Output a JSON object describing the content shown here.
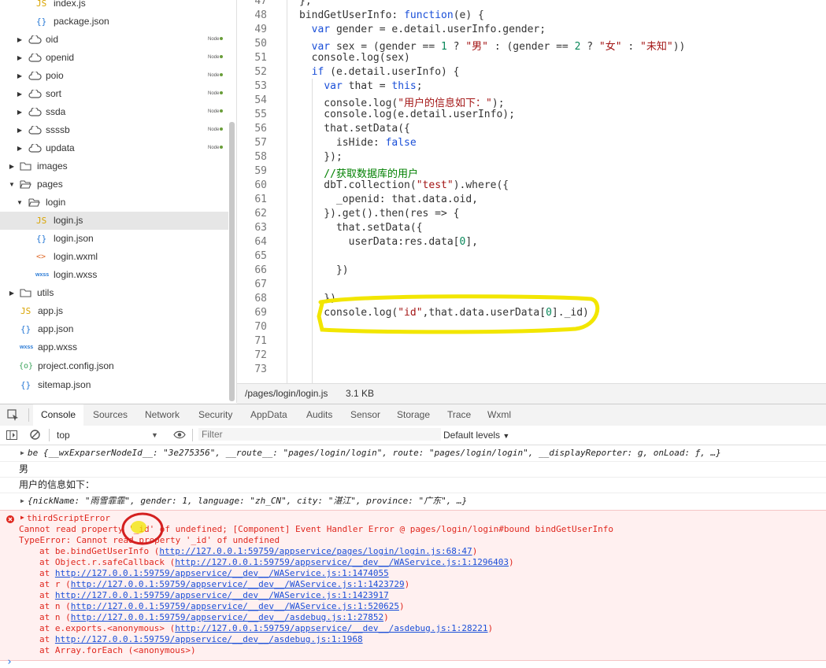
{
  "file_tree": [
    {
      "label": "index.js",
      "icon": "js-file-icon",
      "badge": ""
    },
    {
      "label": "package.json",
      "icon": "json-file-icon",
      "badge": ""
    },
    {
      "label": "oid",
      "icon": "cloud-function-icon",
      "badge": "Node"
    },
    {
      "label": "openid",
      "icon": "cloud-function-icon",
      "badge": "Node"
    },
    {
      "label": "poio",
      "icon": "cloud-function-icon",
      "badge": "Node"
    },
    {
      "label": "sort",
      "icon": "cloud-function-icon",
      "badge": "Node"
    },
    {
      "label": "ssda",
      "icon": "cloud-function-icon",
      "badge": "Node"
    },
    {
      "label": "ssssb",
      "icon": "cloud-function-icon",
      "badge": "Node"
    },
    {
      "label": "updata",
      "icon": "cloud-function-icon",
      "badge": "Node"
    },
    {
      "label": "images",
      "icon": "folder-icon",
      "badge": ""
    },
    {
      "label": "pages",
      "icon": "folder-open-icon",
      "badge": ""
    },
    {
      "label": "login",
      "icon": "folder-open-icon",
      "badge": ""
    },
    {
      "label": "login.js",
      "icon": "js-file-icon",
      "badge": ""
    },
    {
      "label": "login.json",
      "icon": "json-file-icon",
      "badge": ""
    },
    {
      "label": "login.wxml",
      "icon": "wxml-file-icon",
      "badge": ""
    },
    {
      "label": "login.wxss",
      "icon": "wxss-file-icon",
      "badge": ""
    },
    {
      "label": "utils",
      "icon": "folder-icon",
      "badge": ""
    },
    {
      "label": "app.js",
      "icon": "js-file-icon",
      "badge": ""
    },
    {
      "label": "app.json",
      "icon": "json-file-icon",
      "badge": ""
    },
    {
      "label": "app.wxss",
      "icon": "wxss-file-icon",
      "badge": ""
    },
    {
      "label": "project.config.json",
      "icon": "config-file-icon",
      "badge": ""
    },
    {
      "label": "sitemap.json",
      "icon": "json-file-icon",
      "badge": ""
    }
  ],
  "editor": {
    "line_numbers": [
      "47",
      "48",
      "49",
      "50",
      "51",
      "52",
      "53",
      "54",
      "55",
      "56",
      "57",
      "58",
      "59",
      "60",
      "61",
      "62",
      "63",
      "64",
      "65",
      "66",
      "67",
      "68",
      "69",
      "70",
      "71",
      "72",
      "73"
    ],
    "lines": [
      "},",
      "bindGetUserInfo: function(e) {",
      "  var gender = e.detail.userInfo.gender;",
      "  var sex = (gender == 1 ? \"男\" : (gender == 2 ? \"女\" : \"未知\"))",
      "  console.log(sex)",
      "  if (e.detail.userInfo) {",
      "    var that = this;",
      "    console.log(\"用户的信息如下：\");",
      "    console.log(e.detail.userInfo);",
      "    that.setData({",
      "      isHide: false",
      "    });",
      "    //获取数据库的用户",
      "    dbT.collection(\"test\").where({",
      "      _openid: that.data.oid,",
      "    }).get().then(res => {",
      "      that.setData({",
      "        userData:res.data[0],",
      "",
      "      })",
      "",
      "    })",
      "    console.log(\"id\",that.data.userData[0]._id)",
      "",
      "",
      "",
      ""
    ]
  },
  "status_bar": {
    "path": "/pages/login/login.js",
    "size": "3.1 KB"
  },
  "devtools_tabs": [
    "Console",
    "Sources",
    "Network",
    "Security",
    "AppData",
    "Audits",
    "Sensor",
    "Storage",
    "Trace",
    "Wxml"
  ],
  "filter_bar": {
    "context": "top",
    "filter_placeholder": "Filter",
    "levels": "Default levels"
  },
  "console": {
    "row1": "be {__wxExparserNodeId__: \"3e275356\", __route__: \"pages/login/login\", route: \"pages/login/login\", __displayReporter: g, onLoad: ƒ, …}",
    "row2": "男",
    "row3": "用户的信息如下：",
    "row4": "{nickName: \"雨雪霏霏\", gender: 1, language: \"zh_CN\", city: \"湛江\", province: \"广东\", …}",
    "error_title": "thirdScriptError",
    "error_lines": [
      "Cannot read property '_id' of undefined; [Component] Event Handler Error @ pages/login/login#bound bindGetUserInfo",
      "TypeError: Cannot read property '_id' of undefined"
    ],
    "stack": [
      {
        "at": "at be.bindGetUserInfo (",
        "url": "http://127.0.0.1:59759/appservice/pages/login/login.js:68:47",
        "end": ")"
      },
      {
        "at": "at Object.r.safeCallback (",
        "url": "http://127.0.0.1:59759/appservice/__dev__/WAService.js:1:1296403",
        "end": ")"
      },
      {
        "at": "at ",
        "url": "http://127.0.0.1:59759/appservice/__dev__/WAService.js:1:1474055",
        "end": ""
      },
      {
        "at": "at r (",
        "url": "http://127.0.0.1:59759/appservice/__dev__/WAService.js:1:1423729",
        "end": ")"
      },
      {
        "at": "at ",
        "url": "http://127.0.0.1:59759/appservice/__dev__/WAService.js:1:1423917",
        "end": ""
      },
      {
        "at": "at n (",
        "url": "http://127.0.0.1:59759/appservice/__dev__/WAService.js:1:520625",
        "end": ")"
      },
      {
        "at": "at n (",
        "url": "http://127.0.0.1:59759/appservice/__dev__/asdebug.js:1:27852",
        "end": ")"
      },
      {
        "at": "at e.exports.<anonymous> (",
        "url": "http://127.0.0.1:59759/appservice/__dev__/asdebug.js:1:28221",
        "end": ")"
      },
      {
        "at": "at ",
        "url": "http://127.0.0.1:59759/appservice/__dev__/asdebug.js:1:1968",
        "end": ""
      },
      {
        "at": "at Array.forEach (<anonymous>)",
        "url": "",
        "end": ""
      }
    ],
    "prompt": "›"
  },
  "colors": {
    "highlight": "#f2e600",
    "error_circle": "#d42020"
  }
}
